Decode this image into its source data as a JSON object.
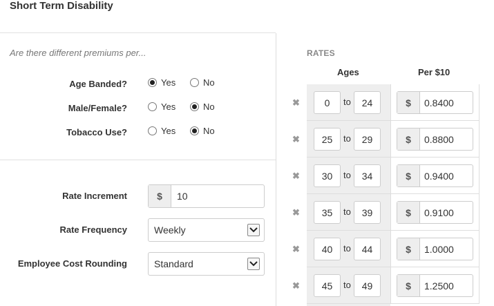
{
  "title": "Short Term Disability",
  "left": {
    "prompt": "Are there different premiums per...",
    "questions": [
      {
        "label": "Age Banded?",
        "yes_label": "Yes",
        "no_label": "No",
        "selected": "Yes"
      },
      {
        "label": "Male/Female?",
        "yes_label": "Yes",
        "no_label": "No",
        "selected": "No"
      },
      {
        "label": "Tobacco Use?",
        "yes_label": "Yes",
        "no_label": "No",
        "selected": "No"
      }
    ],
    "rate_increment": {
      "label": "Rate Increment",
      "currency": "$",
      "value": "10"
    },
    "rate_frequency": {
      "label": "Rate Frequency",
      "value": "Weekly"
    },
    "cost_rounding": {
      "label": "Employee Cost Rounding",
      "value": "Standard"
    }
  },
  "rates": {
    "title": "RATES",
    "ages_header": "Ages",
    "per_header": "Per $10",
    "to_label": "to",
    "currency": "$",
    "rows": [
      {
        "from": "0",
        "to": "24",
        "rate": "0.8400"
      },
      {
        "from": "25",
        "to": "29",
        "rate": "0.8800"
      },
      {
        "from": "30",
        "to": "34",
        "rate": "0.9400"
      },
      {
        "from": "35",
        "to": "39",
        "rate": "0.9100"
      },
      {
        "from": "40",
        "to": "44",
        "rate": "1.0000"
      },
      {
        "from": "45",
        "to": "49",
        "rate": "1.2500"
      }
    ]
  }
}
